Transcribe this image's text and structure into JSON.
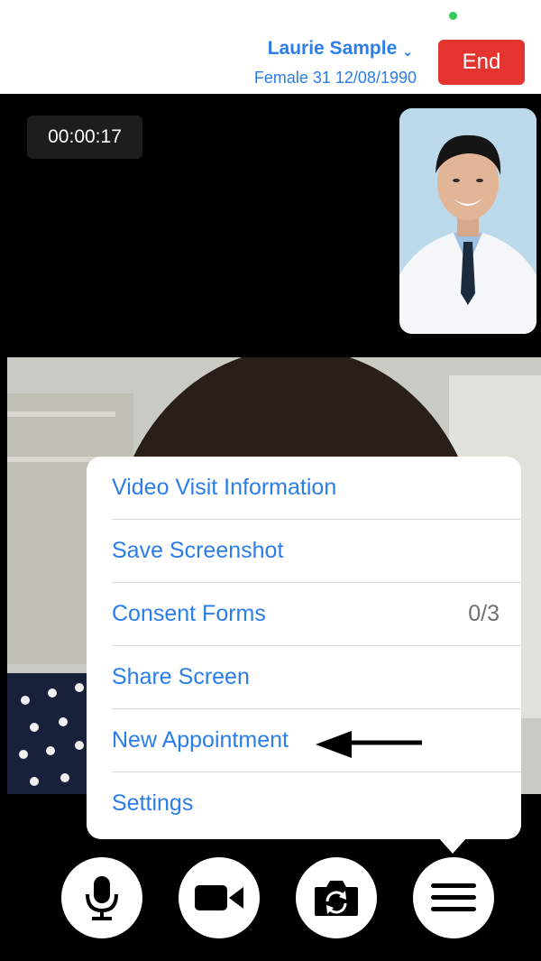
{
  "header": {
    "patient_name": "Laurie Sample",
    "patient_info": "Female 31 12/08/1990",
    "end_label": "End",
    "status_color": "#3ac759"
  },
  "call": {
    "timer": "00:00:17"
  },
  "menu": {
    "items": [
      {
        "label": "Video Visit Information"
      },
      {
        "label": "Save Screenshot"
      },
      {
        "label": "Consent Forms",
        "count": "0/3"
      },
      {
        "label": "Share Screen"
      },
      {
        "label": "New Appointment"
      },
      {
        "label": "Settings"
      }
    ]
  },
  "controls": {
    "icons": [
      "microphone-icon",
      "video-camera-icon",
      "switch-camera-icon",
      "menu-icon"
    ]
  },
  "colors": {
    "accent": "#2b7de9",
    "end_button": "#e3342f"
  }
}
